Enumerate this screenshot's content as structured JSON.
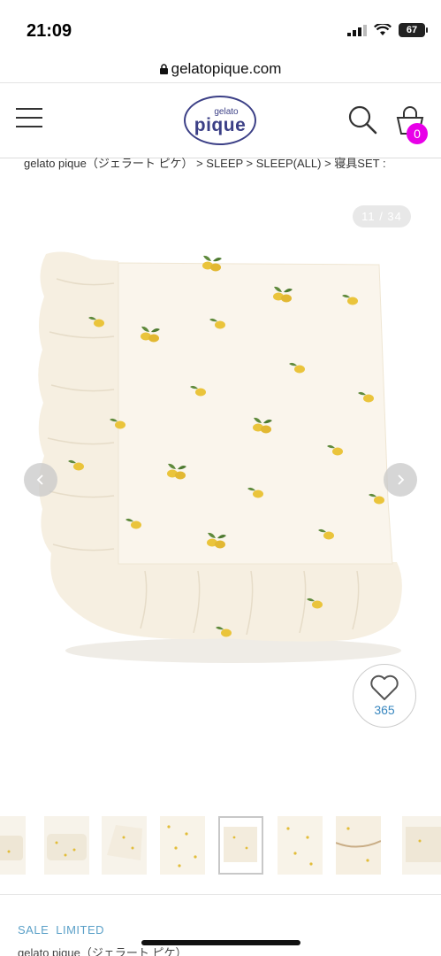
{
  "status": {
    "time": "21:09",
    "battery": "67"
  },
  "browser": {
    "url": "gelatopique.com"
  },
  "header": {
    "logo_small": "gelato",
    "logo_big": "pique",
    "cart_count": "0"
  },
  "breadcrumb": "gelato pique（ジェラート ピケ） > SLEEP > SLEEP(ALL) > 寝具SET :",
  "gallery": {
    "counter": "11 / 34",
    "favorites": "365"
  },
  "product": {
    "tags": [
      "SALE",
      "LIMITED"
    ],
    "brand": "gelato pique（ジェラート ピケ）"
  },
  "icons": [
    "menu-icon",
    "search-icon",
    "cart-icon",
    "chevron-left-icon",
    "chevron-right-icon",
    "heart-icon",
    "lock-icon"
  ],
  "colors": {
    "logo": "#3b3f86",
    "badge": "#e800e8",
    "fav_count": "#3a88c0",
    "sale_tag": "#5ba0c8"
  }
}
